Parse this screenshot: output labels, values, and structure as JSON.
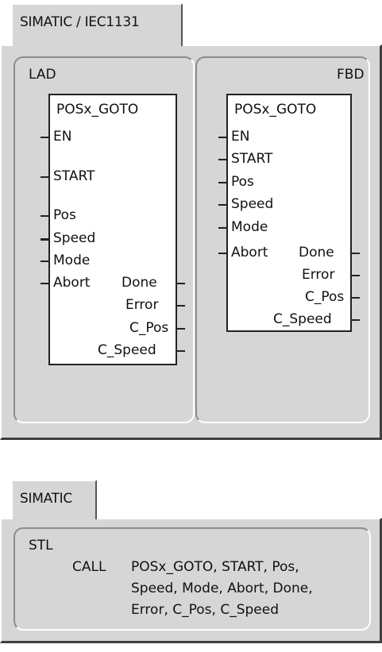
{
  "top_tab": {
    "label": "SIMATIC / IEC1131"
  },
  "lad": {
    "header": "LAD",
    "title": "POSx_GOTO",
    "inputs": [
      "EN",
      "START",
      "Pos",
      "Speed",
      "Mode",
      "Abort"
    ],
    "outputs": [
      "Done",
      "Error",
      "C_Pos",
      "C_Speed"
    ]
  },
  "fbd": {
    "header": "FBD",
    "title": "POSx_GOTO",
    "inputs": [
      "EN",
      "START",
      "Pos",
      "Speed",
      "Mode",
      "Abort"
    ],
    "outputs": [
      "Done",
      "Error",
      "C_Pos",
      "C_Speed"
    ]
  },
  "bottom_tab": {
    "label": "SIMATIC"
  },
  "stl": {
    "header": "STL",
    "keyword": "CALL",
    "lines": [
      "POSx_GOTO, START, Pos,",
      "Speed, Mode, Abort, Done,",
      "Error, C_Pos, C_Speed"
    ]
  }
}
